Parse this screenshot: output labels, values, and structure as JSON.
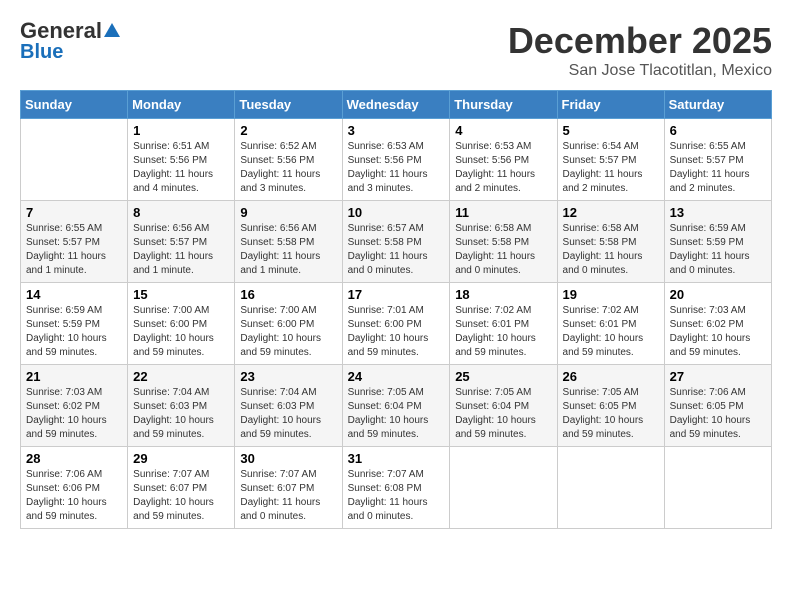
{
  "logo": {
    "general": "General",
    "blue": "Blue"
  },
  "title": "December 2025",
  "subtitle": "San Jose Tlacotitlan, Mexico",
  "days_of_week": [
    "Sunday",
    "Monday",
    "Tuesday",
    "Wednesday",
    "Thursday",
    "Friday",
    "Saturday"
  ],
  "weeks": [
    [
      {
        "day": "",
        "info": ""
      },
      {
        "day": "1",
        "info": "Sunrise: 6:51 AM\nSunset: 5:56 PM\nDaylight: 11 hours\nand 4 minutes."
      },
      {
        "day": "2",
        "info": "Sunrise: 6:52 AM\nSunset: 5:56 PM\nDaylight: 11 hours\nand 3 minutes."
      },
      {
        "day": "3",
        "info": "Sunrise: 6:53 AM\nSunset: 5:56 PM\nDaylight: 11 hours\nand 3 minutes."
      },
      {
        "day": "4",
        "info": "Sunrise: 6:53 AM\nSunset: 5:56 PM\nDaylight: 11 hours\nand 2 minutes."
      },
      {
        "day": "5",
        "info": "Sunrise: 6:54 AM\nSunset: 5:57 PM\nDaylight: 11 hours\nand 2 minutes."
      },
      {
        "day": "6",
        "info": "Sunrise: 6:55 AM\nSunset: 5:57 PM\nDaylight: 11 hours\nand 2 minutes."
      }
    ],
    [
      {
        "day": "7",
        "info": "Sunrise: 6:55 AM\nSunset: 5:57 PM\nDaylight: 11 hours\nand 1 minute."
      },
      {
        "day": "8",
        "info": "Sunrise: 6:56 AM\nSunset: 5:57 PM\nDaylight: 11 hours\nand 1 minute."
      },
      {
        "day": "9",
        "info": "Sunrise: 6:56 AM\nSunset: 5:58 PM\nDaylight: 11 hours\nand 1 minute."
      },
      {
        "day": "10",
        "info": "Sunrise: 6:57 AM\nSunset: 5:58 PM\nDaylight: 11 hours\nand 0 minutes."
      },
      {
        "day": "11",
        "info": "Sunrise: 6:58 AM\nSunset: 5:58 PM\nDaylight: 11 hours\nand 0 minutes."
      },
      {
        "day": "12",
        "info": "Sunrise: 6:58 AM\nSunset: 5:58 PM\nDaylight: 11 hours\nand 0 minutes."
      },
      {
        "day": "13",
        "info": "Sunrise: 6:59 AM\nSunset: 5:59 PM\nDaylight: 11 hours\nand 0 minutes."
      }
    ],
    [
      {
        "day": "14",
        "info": "Sunrise: 6:59 AM\nSunset: 5:59 PM\nDaylight: 10 hours\nand 59 minutes."
      },
      {
        "day": "15",
        "info": "Sunrise: 7:00 AM\nSunset: 6:00 PM\nDaylight: 10 hours\nand 59 minutes."
      },
      {
        "day": "16",
        "info": "Sunrise: 7:00 AM\nSunset: 6:00 PM\nDaylight: 10 hours\nand 59 minutes."
      },
      {
        "day": "17",
        "info": "Sunrise: 7:01 AM\nSunset: 6:00 PM\nDaylight: 10 hours\nand 59 minutes."
      },
      {
        "day": "18",
        "info": "Sunrise: 7:02 AM\nSunset: 6:01 PM\nDaylight: 10 hours\nand 59 minutes."
      },
      {
        "day": "19",
        "info": "Sunrise: 7:02 AM\nSunset: 6:01 PM\nDaylight: 10 hours\nand 59 minutes."
      },
      {
        "day": "20",
        "info": "Sunrise: 7:03 AM\nSunset: 6:02 PM\nDaylight: 10 hours\nand 59 minutes."
      }
    ],
    [
      {
        "day": "21",
        "info": "Sunrise: 7:03 AM\nSunset: 6:02 PM\nDaylight: 10 hours\nand 59 minutes."
      },
      {
        "day": "22",
        "info": "Sunrise: 7:04 AM\nSunset: 6:03 PM\nDaylight: 10 hours\nand 59 minutes."
      },
      {
        "day": "23",
        "info": "Sunrise: 7:04 AM\nSunset: 6:03 PM\nDaylight: 10 hours\nand 59 minutes."
      },
      {
        "day": "24",
        "info": "Sunrise: 7:05 AM\nSunset: 6:04 PM\nDaylight: 10 hours\nand 59 minutes."
      },
      {
        "day": "25",
        "info": "Sunrise: 7:05 AM\nSunset: 6:04 PM\nDaylight: 10 hours\nand 59 minutes."
      },
      {
        "day": "26",
        "info": "Sunrise: 7:05 AM\nSunset: 6:05 PM\nDaylight: 10 hours\nand 59 minutes."
      },
      {
        "day": "27",
        "info": "Sunrise: 7:06 AM\nSunset: 6:05 PM\nDaylight: 10 hours\nand 59 minutes."
      }
    ],
    [
      {
        "day": "28",
        "info": "Sunrise: 7:06 AM\nSunset: 6:06 PM\nDaylight: 10 hours\nand 59 minutes."
      },
      {
        "day": "29",
        "info": "Sunrise: 7:07 AM\nSunset: 6:07 PM\nDaylight: 10 hours\nand 59 minutes."
      },
      {
        "day": "30",
        "info": "Sunrise: 7:07 AM\nSunset: 6:07 PM\nDaylight: 11 hours\nand 0 minutes."
      },
      {
        "day": "31",
        "info": "Sunrise: 7:07 AM\nSunset: 6:08 PM\nDaylight: 11 hours\nand 0 minutes."
      },
      {
        "day": "",
        "info": ""
      },
      {
        "day": "",
        "info": ""
      },
      {
        "day": "",
        "info": ""
      }
    ]
  ]
}
